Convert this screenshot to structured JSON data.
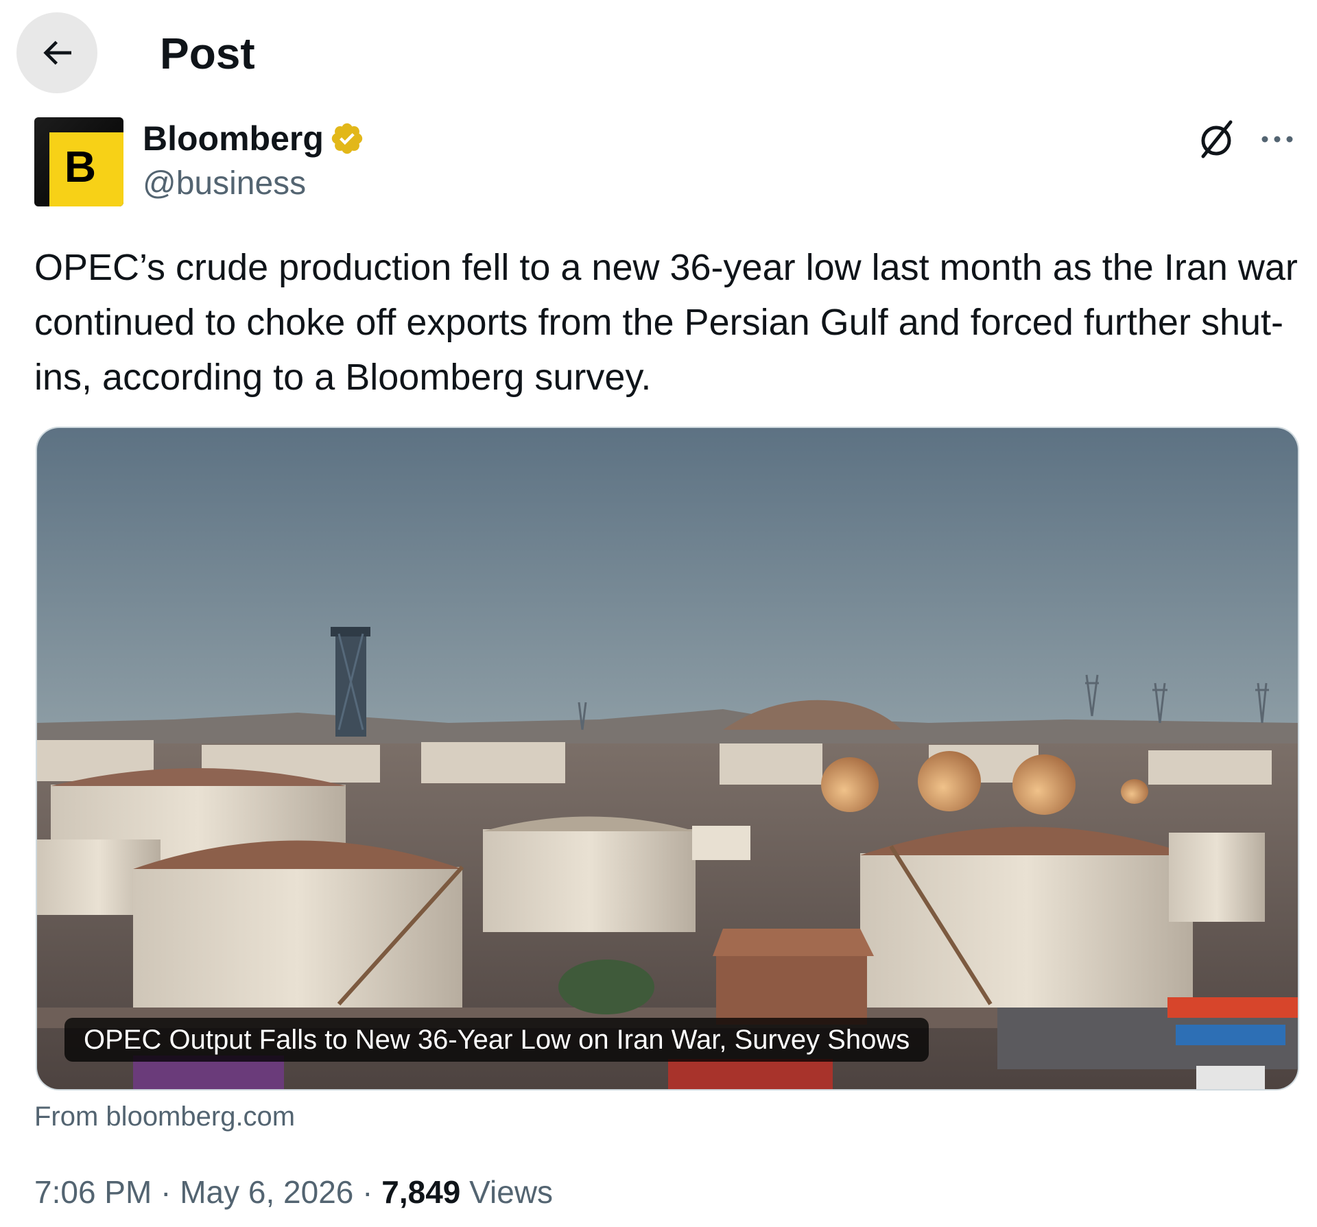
{
  "header": {
    "title": "Post",
    "back_icon": "arrow-left-icon"
  },
  "author": {
    "name": "Bloomberg",
    "handle": "@business",
    "avatar_letter": "B",
    "avatar_color": "#f7d117",
    "verified_badge_color": "#e2b719"
  },
  "actions": {
    "grok_icon": "grok-slash-circle-icon",
    "more_icon": "more-horizontal-icon"
  },
  "post": {
    "text": "OPEC’s crude production fell to a new 36-year low last month as the Iran war continued to choke off exports from the Persian Gulf and forced further shut-ins, according to a Bloomberg survey."
  },
  "card": {
    "headline": "OPEC Output Falls to New 36-Year Low on Iran War, Survey Shows",
    "source": "From bloomberg.com"
  },
  "meta": {
    "time": "7:06 PM",
    "separator": "·",
    "date": "May 6, 2026",
    "views_count": "7,849",
    "views_label": "Views"
  },
  "colors": {
    "text_primary": "#0f1419",
    "text_secondary": "#536471",
    "border": "#cfd9de"
  }
}
